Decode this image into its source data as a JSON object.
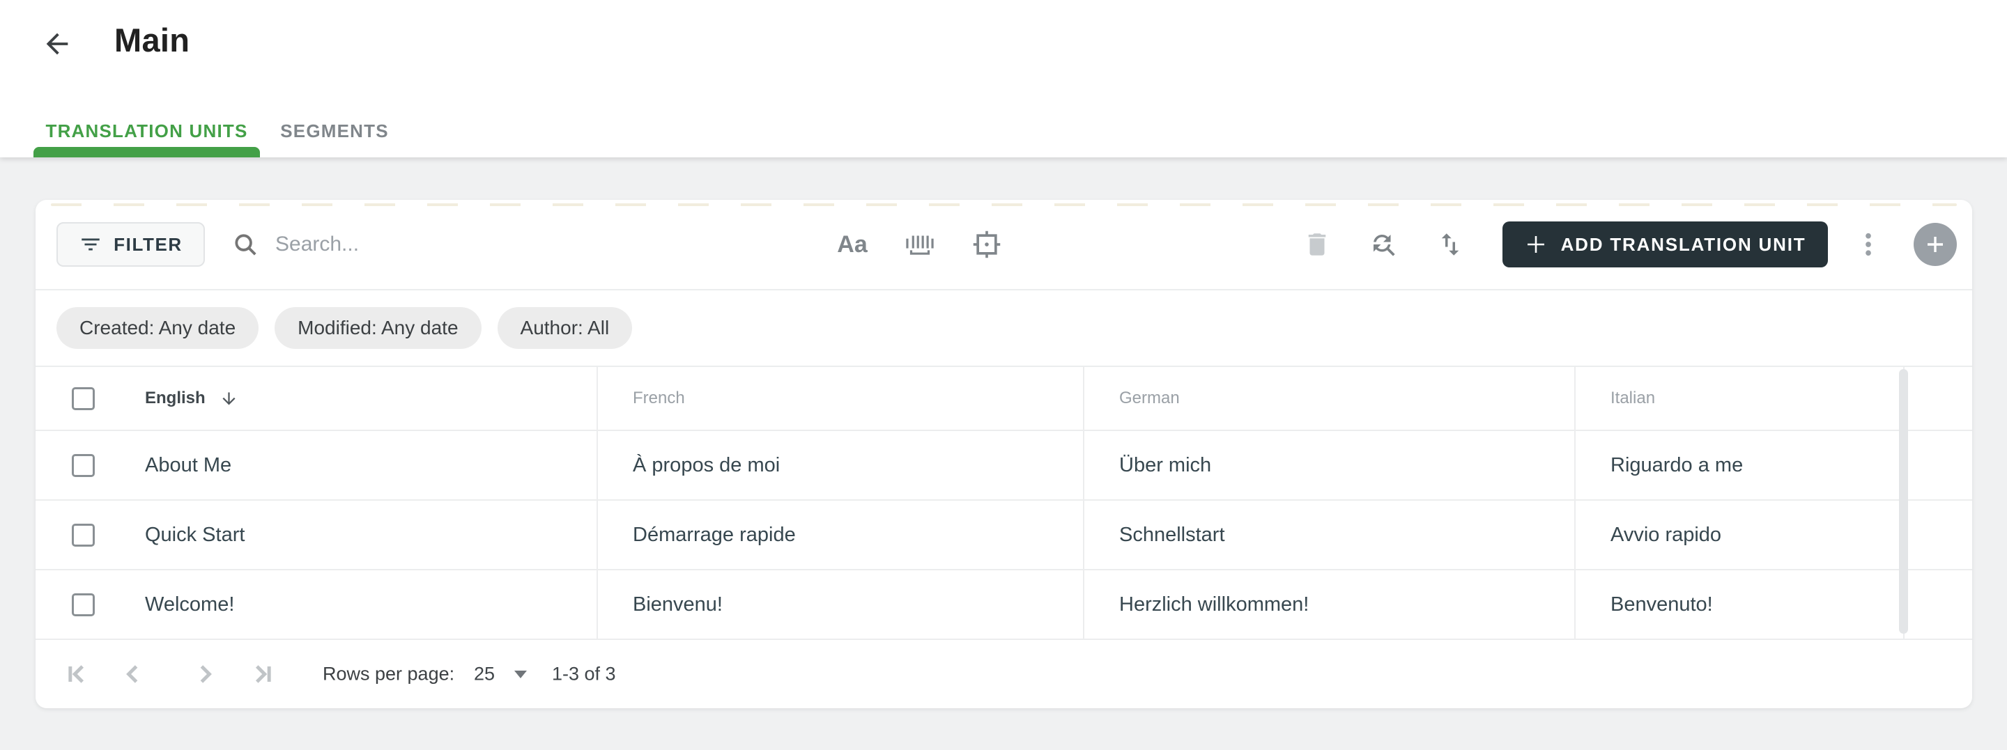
{
  "header": {
    "title": "Main",
    "tabs": [
      {
        "label": "TRANSLATION UNITS",
        "active": true
      },
      {
        "label": "SEGMENTS",
        "active": false
      }
    ]
  },
  "toolbar": {
    "filter_label": "FILTER",
    "search_placeholder": "Search...",
    "match_case_label": "Aa",
    "add_button_label": "ADD TRANSLATION UNIT",
    "icons": [
      "filter-icon",
      "search-icon",
      "match-case-icon",
      "whole-word-icon",
      "selection-frame-icon",
      "trash-icon",
      "find-replace-icon",
      "sort-icon",
      "plus-icon",
      "kebab-icon",
      "fab-plus-icon"
    ]
  },
  "filter_chips": [
    "Created: Any date",
    "Modified: Any date",
    "Author: All"
  ],
  "table": {
    "columns": [
      "English",
      "French",
      "German",
      "Italian"
    ],
    "sort": {
      "column": "English",
      "direction": "desc"
    },
    "rows": [
      [
        "About Me",
        "À propos de moi",
        "Über mich",
        "Riguardo a me"
      ],
      [
        "Quick Start",
        "Démarrage rapide",
        "Schnellstart",
        "Avvio rapido"
      ],
      [
        "Welcome!",
        "Bienvenu!",
        "Herzlich willkommen!",
        "Benvenuto!"
      ]
    ]
  },
  "pagination": {
    "rows_per_page_label": "Rows per page:",
    "rows_per_page_value": "25",
    "range": "1-3 of 3"
  },
  "colors": {
    "accent_green": "#43a047",
    "primary_dark_button": "#263238",
    "page_background": "#f0f1f2"
  }
}
